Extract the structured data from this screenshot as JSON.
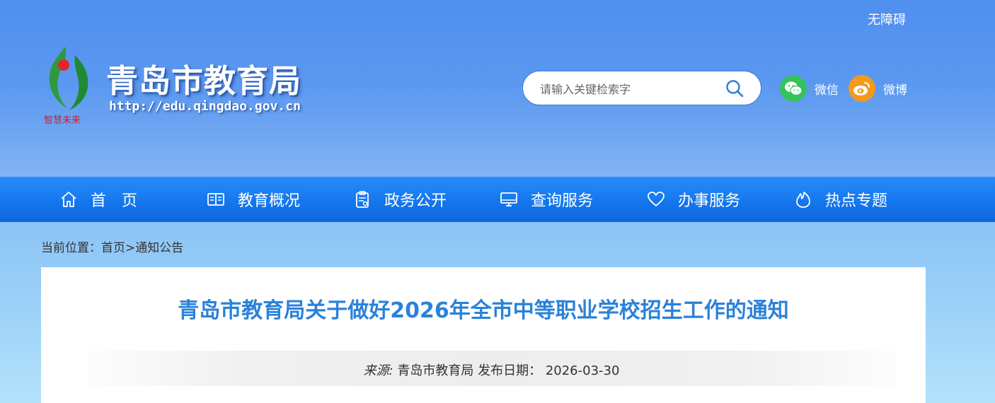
{
  "header": {
    "accessibility_link": "无障碍",
    "site_title": "青岛市教育局",
    "site_url": "http://edu.qingdao.gov.cn",
    "logo_slogan": "智慧未来",
    "search": {
      "placeholder": "请输入关键检索字"
    },
    "social": [
      {
        "label": "微信",
        "icon": "wechat-icon",
        "color": "#35c35a"
      },
      {
        "label": "微博",
        "icon": "weibo-icon",
        "color": "#f39a1c"
      }
    ]
  },
  "nav": {
    "items": [
      {
        "label": "首　页",
        "icon": "home-icon"
      },
      {
        "label": "教育概况",
        "icon": "book-icon"
      },
      {
        "label": "政务公开",
        "icon": "clipboard-icon"
      },
      {
        "label": "查询服务",
        "icon": "monitor-icon"
      },
      {
        "label": "办事服务",
        "icon": "heart-icon"
      },
      {
        "label": "热点专题",
        "icon": "flame-icon"
      }
    ]
  },
  "breadcrumb": {
    "prefix": "当前位置：",
    "home": "首页",
    "separator": ">",
    "current": "通知公告"
  },
  "article": {
    "title": "青岛市教育局关于做好2026年全市中等职业学校招生工作的通知",
    "source_label": "来源:",
    "source": "青岛市教育局",
    "date_label": "发布日期：",
    "date": "2026-03-30"
  },
  "colors": {
    "nav_bg": "#1577ee",
    "title_blue": "#2a82d9"
  }
}
